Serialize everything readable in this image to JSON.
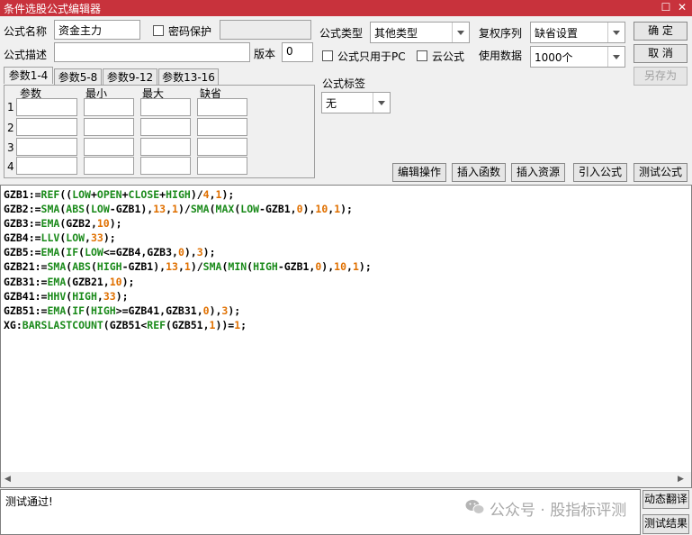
{
  "window": {
    "title": "条件选股公式编辑器",
    "maximize_glyph": "☐",
    "close_glyph": "✕"
  },
  "form": {
    "name_label": "公式名称",
    "name_value": "资金主力",
    "password_label": "密码保护",
    "password_value": "",
    "desc_label": "公式描述",
    "desc_value": "",
    "version_label": "版本",
    "version_value": "0",
    "type_label": "公式类型",
    "type_value": "其他类型",
    "restore_label": "复权序列",
    "restore_value": "缺省设置",
    "pc_only_label": "公式只用于PC",
    "cloud_label": "云公式",
    "data_label": "使用数据",
    "data_value": "1000个",
    "tag_label": "公式标签",
    "tag_value": "无"
  },
  "buttons": {
    "ok": "确  定",
    "cancel": "取  消",
    "save_as": "另存为",
    "edit_ops": "编辑操作",
    "insert_func": "插入函数",
    "insert_res": "插入资源",
    "import": "引入公式",
    "test": "测试公式",
    "translate": "动态翻译",
    "test_result": "测试结果"
  },
  "params": {
    "tabs": [
      "参数1-4",
      "参数5-8",
      "参数9-12",
      "参数13-16"
    ],
    "headers": [
      "参数",
      "最小",
      "最大",
      "缺省"
    ],
    "rows": [
      "1",
      "2",
      "3",
      "4"
    ]
  },
  "code": {
    "lines": [
      [
        [
          "GZB1:=",
          ""
        ],
        [
          "REF",
          "g"
        ],
        [
          "((",
          ""
        ],
        [
          "LOW",
          "g"
        ],
        [
          "+",
          ""
        ],
        [
          "OPEN",
          "g"
        ],
        [
          "+",
          ""
        ],
        [
          "CLOSE",
          "g"
        ],
        [
          "+",
          ""
        ],
        [
          "HIGH",
          "g"
        ],
        [
          ")/",
          ""
        ],
        [
          "4",
          "o"
        ],
        [
          ",",
          ""
        ],
        [
          "1",
          "o"
        ],
        [
          ");",
          ""
        ]
      ],
      [
        [
          "GZB2:=",
          ""
        ],
        [
          "SMA",
          "g"
        ],
        [
          "(",
          ""
        ],
        [
          "ABS",
          "g"
        ],
        [
          "(",
          ""
        ],
        [
          "LOW",
          "g"
        ],
        [
          "-GZB1),",
          ""
        ],
        [
          "13",
          "o"
        ],
        [
          ",",
          ""
        ],
        [
          "1",
          "o"
        ],
        [
          ")/",
          ""
        ],
        [
          "SMA",
          "g"
        ],
        [
          "(",
          ""
        ],
        [
          "MAX",
          "g"
        ],
        [
          "(",
          ""
        ],
        [
          "LOW",
          "g"
        ],
        [
          "-GZB1,",
          ""
        ],
        [
          "0",
          "o"
        ],
        [
          "),",
          ""
        ],
        [
          "10",
          "o"
        ],
        [
          ",",
          ""
        ],
        [
          "1",
          "o"
        ],
        [
          ");",
          ""
        ]
      ],
      [
        [
          "GZB3:=",
          ""
        ],
        [
          "EMA",
          "g"
        ],
        [
          "(GZB2,",
          ""
        ],
        [
          "10",
          "o"
        ],
        [
          ");",
          ""
        ]
      ],
      [
        [
          "GZB4:=",
          ""
        ],
        [
          "LLV",
          "g"
        ],
        [
          "(",
          ""
        ],
        [
          "LOW",
          "g"
        ],
        [
          ",",
          ""
        ],
        [
          "33",
          "o"
        ],
        [
          ");",
          ""
        ]
      ],
      [
        [
          "GZB5:=",
          ""
        ],
        [
          "EMA",
          "g"
        ],
        [
          "(",
          ""
        ],
        [
          "IF",
          "g"
        ],
        [
          "(",
          ""
        ],
        [
          "LOW",
          "g"
        ],
        [
          "<=GZB4,GZB3,",
          ""
        ],
        [
          "0",
          "o"
        ],
        [
          "),",
          ""
        ],
        [
          "3",
          "o"
        ],
        [
          ");",
          ""
        ]
      ],
      [
        [
          "GZB21:=",
          ""
        ],
        [
          "SMA",
          "g"
        ],
        [
          "(",
          ""
        ],
        [
          "ABS",
          "g"
        ],
        [
          "(",
          ""
        ],
        [
          "HIGH",
          "g"
        ],
        [
          "-GZB1),",
          ""
        ],
        [
          "13",
          "o"
        ],
        [
          ",",
          ""
        ],
        [
          "1",
          "o"
        ],
        [
          ")/",
          ""
        ],
        [
          "SMA",
          "g"
        ],
        [
          "(",
          ""
        ],
        [
          "MIN",
          "g"
        ],
        [
          "(",
          ""
        ],
        [
          "HIGH",
          "g"
        ],
        [
          "-GZB1,",
          ""
        ],
        [
          "0",
          "o"
        ],
        [
          "),",
          ""
        ],
        [
          "10",
          "o"
        ],
        [
          ",",
          ""
        ],
        [
          "1",
          "o"
        ],
        [
          ");",
          ""
        ]
      ],
      [
        [
          "GZB31:=",
          ""
        ],
        [
          "EMA",
          "g"
        ],
        [
          "(GZB21,",
          ""
        ],
        [
          "10",
          "o"
        ],
        [
          ");",
          ""
        ]
      ],
      [
        [
          "GZB41:=",
          ""
        ],
        [
          "HHV",
          "g"
        ],
        [
          "(",
          ""
        ],
        [
          "HIGH",
          "g"
        ],
        [
          ",",
          ""
        ],
        [
          "33",
          "o"
        ],
        [
          ");",
          ""
        ]
      ],
      [
        [
          "GZB51:=",
          ""
        ],
        [
          "EMA",
          "g"
        ],
        [
          "(",
          ""
        ],
        [
          "IF",
          "g"
        ],
        [
          "(",
          ""
        ],
        [
          "HIGH",
          "g"
        ],
        [
          ">=GZB41,GZB31,",
          ""
        ],
        [
          "0",
          "o"
        ],
        [
          "),",
          ""
        ],
        [
          "3",
          "o"
        ],
        [
          ");",
          ""
        ]
      ],
      [
        [
          "XG:",
          ""
        ],
        [
          "BARSLASTCOUNT",
          "g"
        ],
        [
          "(GZB51<",
          ""
        ],
        [
          "REF",
          "g"
        ],
        [
          "(GZB51,",
          ""
        ],
        [
          "1",
          "o"
        ],
        [
          "))=",
          ""
        ],
        [
          "1",
          "o"
        ],
        [
          ";",
          ""
        ]
      ]
    ]
  },
  "output": {
    "text": "测试通过!",
    "watermark": "公众号 · 股指标评测"
  }
}
